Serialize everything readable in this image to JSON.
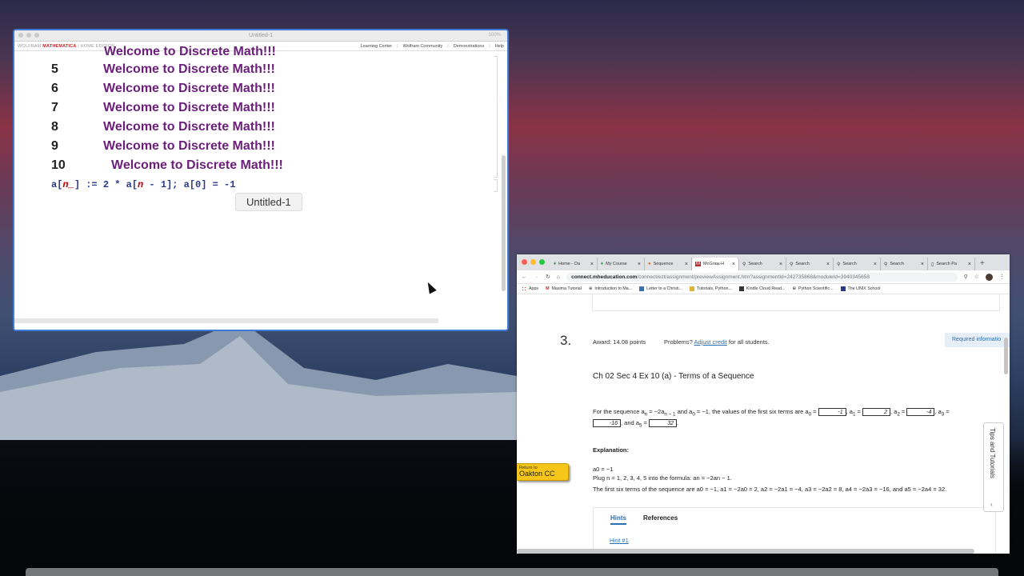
{
  "mathematica": {
    "window_title": "Untitled-1",
    "zoom": "100%",
    "brand_prefix": "WOLFRAM ",
    "brand_name": "MATHEMATICA",
    "brand_suffix": " | HOME EDITION",
    "menu": [
      "Learning Center",
      "Wolfram Community",
      "Demonstrations",
      "Help"
    ],
    "cut_row": "Welcome to Discrete Math!!!",
    "rows": [
      {
        "num": "5",
        "text": "Welcome to Discrete Math!!!"
      },
      {
        "num": "6",
        "text": "Welcome to Discrete Math!!!"
      },
      {
        "num": "7",
        "text": "Welcome to Discrete Math!!!"
      },
      {
        "num": "8",
        "text": "Welcome to Discrete Math!!!"
      },
      {
        "num": "9",
        "text": "Welcome to Discrete Math!!!"
      },
      {
        "num": "10",
        "text": "Welcome to Discrete Math!!!"
      }
    ],
    "code_prefix": "a[",
    "code_var1": "n_",
    "code_mid": "] := 2 * a[",
    "code_var2": "n",
    "code_suffix": " - 1]; a[0] = -1",
    "tooltip": "Untitled-1"
  },
  "browser": {
    "tabs": [
      {
        "label": "Home - Oa",
        "icon": "leaf-icon"
      },
      {
        "label": "My Course",
        "icon": "leaf-icon"
      },
      {
        "label": "Sequence",
        "icon": "d-icon"
      },
      {
        "label": "McGraw-H",
        "icon": "m-icon",
        "active": true
      },
      {
        "label": "Search",
        "icon": "search-icon"
      },
      {
        "label": "Search",
        "icon": "search-icon"
      },
      {
        "label": "Search",
        "icon": "search-icon"
      },
      {
        "label": "Search",
        "icon": "search-icon"
      },
      {
        "label": "Search Pa",
        "icon": "doc-icon"
      }
    ],
    "url_host": "connect.mheducation.com",
    "url_path": "/connect/ezt/assignment/previewAssignment.htm?assignmentId=242735868&moduleId=3940345658",
    "bookmarks": [
      "Apps",
      "Maxima Tutorial",
      "Introduction to Ma...",
      "Letter to a Christi...",
      "Tutorials, Python...",
      "Kindle Cloud Read...",
      "Python Scientific...",
      "The UNIX School"
    ],
    "question": {
      "number": "3.",
      "award": "Award: 14.08 points",
      "problems_prefix": "Problems?",
      "problems_link": "Adjust credit",
      "problems_suffix": "for all students.",
      "required": "Required informatio",
      "title": "Ch 02 Sec 4 Ex 10 (a) - Terms of a Sequence",
      "intro_1": "For the sequence a",
      "intro_2": "n",
      "intro_3": " = −2a",
      "intro_4": "n − 1",
      "intro_5": " and a",
      "intro_6": "0",
      "intro_7": " = −1, the values of the first six terms are a",
      "intro_8": "0",
      "intro_9": " =",
      "a1_lbl": "a",
      "a1_sub": "1",
      "a2_sub": "2",
      "a3_sub": "3",
      "a5_sub": "5",
      "and_text": ", and a",
      "answers": {
        "a0": "-1",
        "a1": "2",
        "a2": "-4",
        "a4": "-16",
        "a5": "32"
      },
      "explanation_title": "Explanation:",
      "exp_line1": "a0 = −1",
      "exp_line2": "Plug n = 1, 2, 3, 4, 5 into the formula: an = −2an − 1.",
      "exp_line3": "The first six terms of the sequence are a0 = −1, a1 = −2a0 = 2, a2 = −2a1 = −4, a3 = −2a2 = 8, a4 = −2a3 = −16, and a5 = −2a4 = 32.",
      "tab_hints": "Hints",
      "tab_references": "References",
      "hint1": "Hint #1"
    },
    "return_small": "Return to",
    "return_big": "Oakton CC",
    "tips": "Tips and Tutorials"
  },
  "colors": {
    "accent": "#2a6fb3",
    "brand": "#c0282e",
    "output": "#6b1f7a"
  }
}
